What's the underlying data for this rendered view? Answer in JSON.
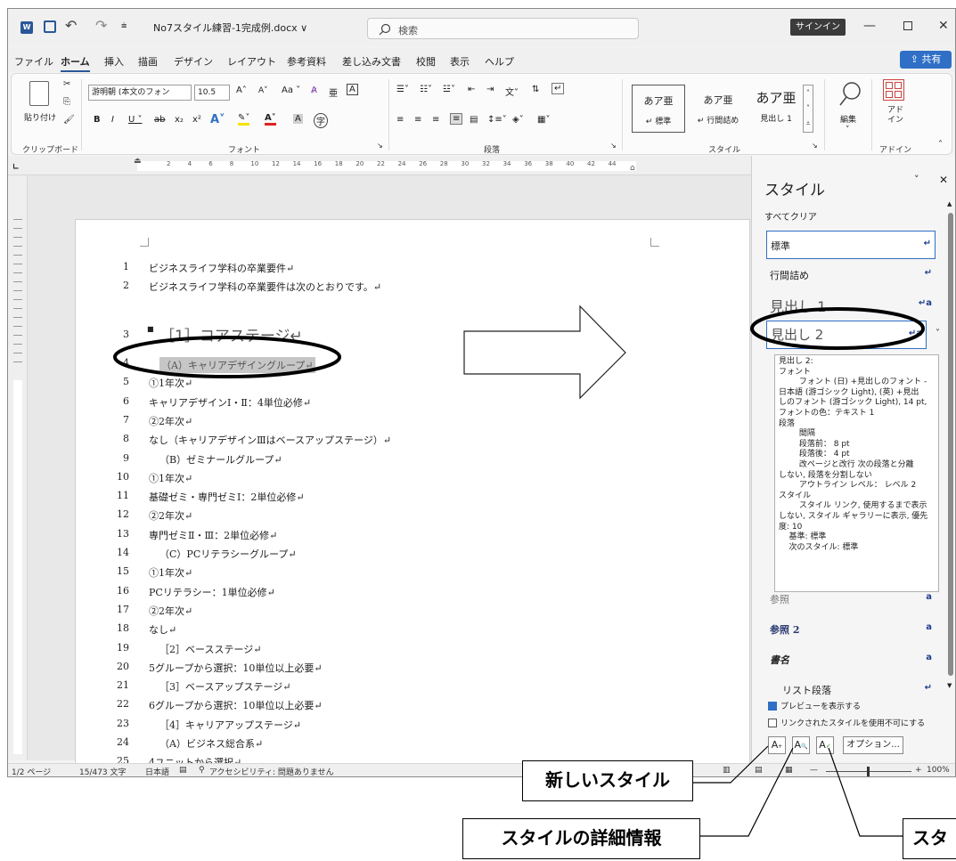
{
  "window": {
    "file_name": "No7スタイル練習-1完成例.docx ∨",
    "search_placeholder": "検索",
    "signin_label": "サインイン",
    "share_label": "共有"
  },
  "menu": [
    "ファイル",
    "ホーム",
    "挿入",
    "描画",
    "デザイン",
    "レイアウト",
    "参考資料",
    "差し込み文書",
    "校閲",
    "表示",
    "ヘルプ"
  ],
  "ribbon": {
    "paste_label": "貼り付け",
    "font_name": "游明朝 (本文のフォン",
    "font_size": "10.5",
    "clipboard_label": "クリップボード",
    "font_label": "フォント",
    "paragraph_label": "段落",
    "styles_label": "スタイル",
    "addin_label": "アドイン",
    "edit_label": "編集",
    "addin_btn": "アド\nイン",
    "styles_gallery": [
      {
        "preview": "あア亜",
        "name": "↵ 標準"
      },
      {
        "preview": "あア亜",
        "name": "↵ 行間詰め"
      },
      {
        "preview": "あア亜",
        "name": "見出し 1"
      }
    ]
  },
  "ruler_ticks": [
    "2",
    "4",
    "6",
    "8",
    "10",
    "12",
    "14",
    "16",
    "18",
    "20",
    "22",
    "24",
    "26",
    "28",
    "30",
    "32",
    "34",
    "36",
    "38",
    "40",
    "42",
    "44"
  ],
  "document": {
    "lines": [
      {
        "n": "1",
        "t": "ビジネスライフ学科の卒業要件↵"
      },
      {
        "n": "2",
        "t": "ビジネスライフ学科の卒業要件は次のとおりです。↵"
      },
      {
        "n": "3",
        "t": "［1］コアステージ↵"
      },
      {
        "n": "4",
        "t": "（A）キャリアデザイングループ↵"
      },
      {
        "n": "5",
        "t": "①1年次↵"
      },
      {
        "n": "6",
        "t": "キャリアデザインⅠ・Ⅱ：4単位必修↵"
      },
      {
        "n": "7",
        "t": "②2年次↵"
      },
      {
        "n": "8",
        "t": "なし（キャリアデザインⅢはベースアップステージ）↵"
      },
      {
        "n": "9",
        "t": "（B）ゼミナールグループ↵"
      },
      {
        "n": "10",
        "t": "①1年次↵"
      },
      {
        "n": "11",
        "t": "基礎ゼミ・専門ゼミⅠ：2単位必修↵"
      },
      {
        "n": "12",
        "t": "②2年次↵"
      },
      {
        "n": "13",
        "t": "専門ゼミⅡ・Ⅲ：2単位必修↵"
      },
      {
        "n": "14",
        "t": "（C）PCリテラシーグループ↵"
      },
      {
        "n": "15",
        "t": "①1年次↵"
      },
      {
        "n": "16",
        "t": "PCリテラシー：1単位必修↵"
      },
      {
        "n": "17",
        "t": "②2年次↵"
      },
      {
        "n": "18",
        "t": "なし↵"
      },
      {
        "n": "19",
        "t": "［2］ベースステージ↵"
      },
      {
        "n": "20",
        "t": "5グループから選択：10単位以上必要↵"
      },
      {
        "n": "21",
        "t": "［3］ベースアップステージ↵"
      },
      {
        "n": "22",
        "t": "6グループから選択：10単位以上必要↵"
      },
      {
        "n": "23",
        "t": "［4］キャリアアップステージ↵"
      },
      {
        "n": "24",
        "t": "（A）ビジネス総合系↵"
      },
      {
        "n": "25",
        "t": "4ユニットから選択↵"
      }
    ]
  },
  "styles_pane": {
    "title": "スタイル",
    "clear_all": "すべてクリア",
    "items": [
      {
        "name": "標準",
        "mark": "↵"
      },
      {
        "name": "行間詰め",
        "mark": "↵"
      },
      {
        "name": "見出し 1",
        "mark": "↵a"
      },
      {
        "name": "見出し 2",
        "mark": "↵a"
      },
      {
        "name": "参照",
        "mark": "a"
      },
      {
        "name": "参照 2",
        "mark": "a"
      },
      {
        "name": "書名",
        "mark": "a"
      },
      {
        "name": "リスト段落",
        "mark": "↵"
      }
    ],
    "tooltip": "見出し 2:\nフォント\n        フォント (日) +見出しのフォント -\n日本語 (游ゴシック Light), (英) +見出\nしのフォント (游ゴシック Light), 14 pt,\nフォントの色：テキスト 1\n段落\n        間隔\n        段落前： 8 pt\n        段落後： 4 pt\n        改ページと改行 次の段落と分離\nしない, 段落を分割しない\n        アウトライン レベル： レベル 2\nスタイル\n        スタイル リンク, 使用するまで表示\nしない, スタイル ギャラリーに表示, 優先\n度: 10\n    基準: 標準\n    次のスタイル: 標準",
    "preview_checkbox": "プレビューを表示する",
    "linked_checkbox": "リンクされたスタイルを使用不可にする",
    "options_button": "オプション..."
  },
  "status": {
    "page": "1/2 ページ",
    "words": "15/473 文字",
    "lang": "日本語",
    "accessibility": "アクセシビリティ: 問題ありません",
    "zoom": "100%"
  },
  "callouts": {
    "new_style": "新しいスタイル",
    "inspector": "スタイルの詳細情報",
    "manage": "スタ"
  }
}
